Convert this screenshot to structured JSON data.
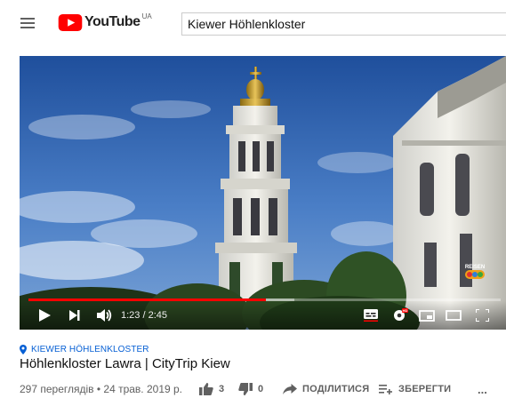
{
  "header": {
    "logo_text": "YouTube",
    "country_code": "UA",
    "search_value": "Kiewer Höhlenkloster"
  },
  "player": {
    "time_display": "1:23 / 2:45",
    "progress_fraction": 0.503,
    "watermark_text": "REISEN"
  },
  "video": {
    "location": "KIEWER HÖHLENKLOSTER",
    "title": "Höhlenkloster Lawra | CityTrip Kiew",
    "stats": "297 переглядів • 24 трав. 2019 р.",
    "likes": "3",
    "dislikes": "0",
    "share_label": "ПОДІЛИТИСЯ",
    "save_label": "ЗБЕРЕГТИ",
    "more_label": "..."
  },
  "colors": {
    "brand_red": "#ff0000",
    "link_blue": "#065fd4",
    "meta_gray": "#606060"
  }
}
